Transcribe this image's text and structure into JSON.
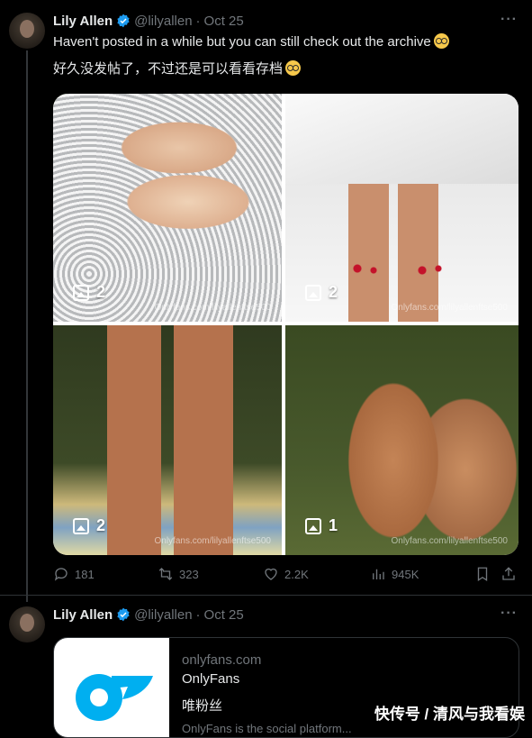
{
  "tweet1": {
    "name": "Lily Allen",
    "handle": "@lilyallen",
    "separator": "·",
    "date": "Oct 25",
    "more": "···",
    "text_en": "Haven't posted in a while but you can still check out the archive",
    "text_zh": "好久没发帖了，不过还是可以看看存档",
    "emoji": "nerd-face-emoji",
    "photos": [
      {
        "count": "2",
        "watermark": "Onlyfans.com/lilyallenftse500"
      },
      {
        "count": "2",
        "watermark": "Onlyfans.com/lilyallenftse500"
      },
      {
        "count": "2",
        "watermark": "Onlyfans.com/lilyallenftse500"
      },
      {
        "count": "1",
        "watermark": "Onlyfans.com/lilyallenftse500"
      }
    ],
    "stats": {
      "replies": "181",
      "reposts": "323",
      "likes": "2.2K",
      "views": "945K"
    }
  },
  "tweet2": {
    "name": "Lily Allen",
    "handle": "@lilyallen",
    "separator": "·",
    "date": "Oct 25",
    "more": "···",
    "card": {
      "domain": "onlyfans.com",
      "title": "OnlyFans",
      "description": "唯粉丝",
      "faded": "OnlyFans is the social platform..."
    }
  },
  "watermark_brand": "快传号 / 清风与我看娱",
  "colors": {
    "background": "#000000",
    "text": "#e7e9ea",
    "muted": "#71767b",
    "verified": "#1d9bf0",
    "onlyfans_blue": "#00aff0"
  }
}
